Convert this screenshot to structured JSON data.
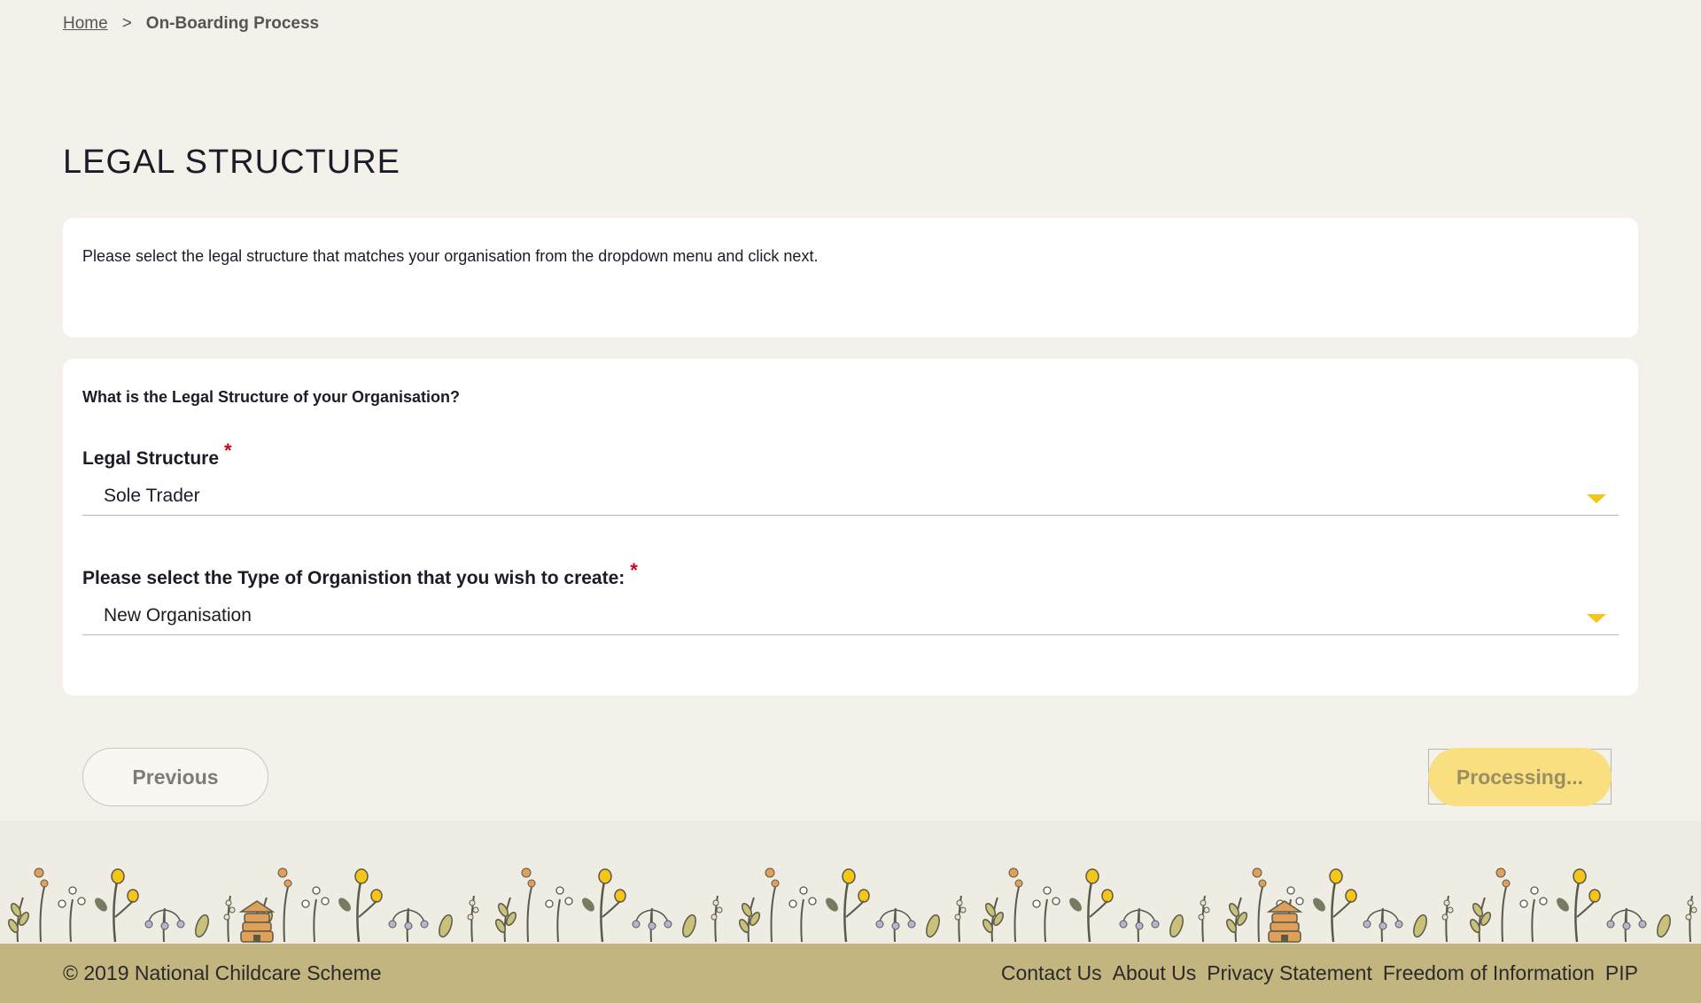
{
  "breadcrumb": {
    "home": "Home",
    "separator": ">",
    "current": "On-Boarding Process"
  },
  "page": {
    "title": "LEGAL STRUCTURE"
  },
  "intro": {
    "text": "Please select the legal structure that matches your organisation from the dropdown menu and click next."
  },
  "form": {
    "question": "What is the Legal Structure of your Organisation?",
    "legal_structure": {
      "label": "Legal Structure",
      "required": "*",
      "value": "Sole Trader"
    },
    "org_type": {
      "label": "Please select the Type of Organistion that you wish to create:",
      "required": "*",
      "value": "New Organisation"
    }
  },
  "buttons": {
    "previous": "Previous",
    "next": "Processing..."
  },
  "footer": {
    "copyright": "© 2019 National Childcare Scheme",
    "links": [
      "Contact Us",
      "About Us",
      "Privacy Statement",
      "Freedom of Information",
      "PIP"
    ]
  },
  "colors": {
    "accent": "#f5c518",
    "footer_bg": "#c3b580",
    "required": "#d0021b"
  },
  "icons": {
    "dropdown": "caret-down-icon",
    "decor": "floral-border-illustration"
  }
}
